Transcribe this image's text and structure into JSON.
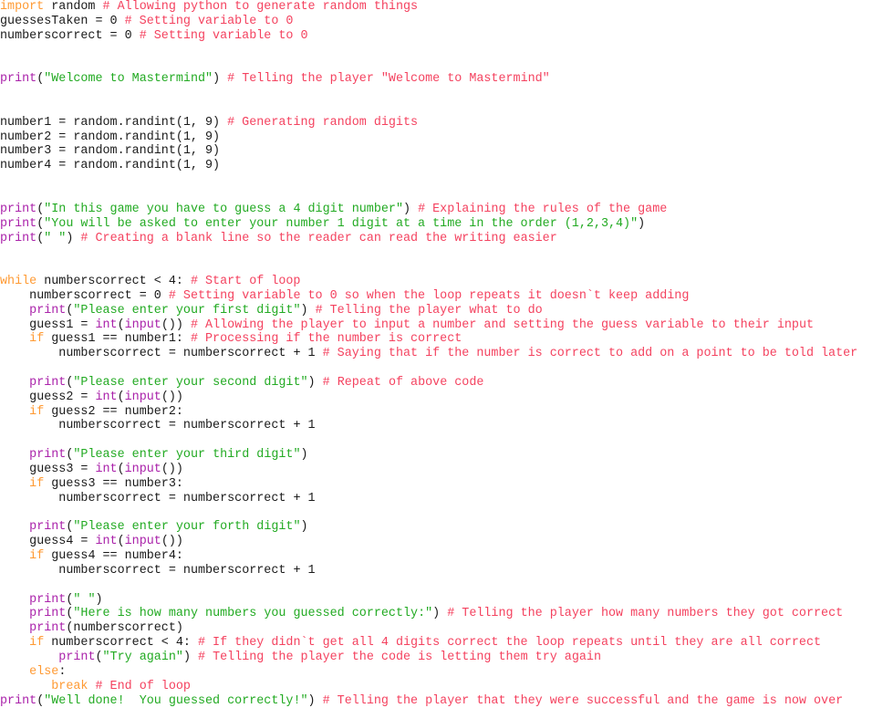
{
  "document": {
    "kind": "source-code-listing",
    "language": "Python",
    "program_title": "Mastermind",
    "background_color": "#ffffff",
    "syntax_colors": {
      "keyword": "#ff9a33",
      "builtin": "#aa22aa",
      "string": "#22aa22",
      "comment": "#f4425f",
      "plain": "#1a1a1a"
    }
  },
  "code": {
    "lines": [
      {
        "n": 1,
        "indent": 0,
        "tokens": [
          {
            "t": "kw",
            "s": "import"
          },
          {
            "t": "plain",
            "s": " random "
          },
          {
            "t": "comment",
            "s": "# Allowing python to generate random things"
          }
        ]
      },
      {
        "n": 2,
        "indent": 0,
        "tokens": [
          {
            "t": "plain",
            "s": "guessesTaken = 0 "
          },
          {
            "t": "comment",
            "s": "# Setting variable to 0"
          }
        ]
      },
      {
        "n": 3,
        "indent": 0,
        "tokens": [
          {
            "t": "plain",
            "s": "numberscorrect = 0 "
          },
          {
            "t": "comment",
            "s": "# Setting variable to 0"
          }
        ]
      },
      {
        "n": 4,
        "indent": 0,
        "tokens": []
      },
      {
        "n": 5,
        "indent": 0,
        "tokens": []
      },
      {
        "n": 6,
        "indent": 0,
        "tokens": [
          {
            "t": "builtin",
            "s": "print"
          },
          {
            "t": "plain",
            "s": "("
          },
          {
            "t": "str",
            "s": "\"Welcome to Mastermind\""
          },
          {
            "t": "plain",
            "s": ") "
          },
          {
            "t": "comment",
            "s": "# Telling the player \"Welcome to Mastermind\""
          }
        ]
      },
      {
        "n": 7,
        "indent": 0,
        "tokens": []
      },
      {
        "n": 8,
        "indent": 0,
        "tokens": []
      },
      {
        "n": 9,
        "indent": 0,
        "tokens": [
          {
            "t": "plain",
            "s": "number1 = random.randint(1, 9) "
          },
          {
            "t": "comment",
            "s": "# Generating random digits"
          }
        ]
      },
      {
        "n": 10,
        "indent": 0,
        "tokens": [
          {
            "t": "plain",
            "s": "number2 = random.randint(1, 9)"
          }
        ]
      },
      {
        "n": 11,
        "indent": 0,
        "tokens": [
          {
            "t": "plain",
            "s": "number3 = random.randint(1, 9)"
          }
        ]
      },
      {
        "n": 12,
        "indent": 0,
        "tokens": [
          {
            "t": "plain",
            "s": "number4 = random.randint(1, 9)"
          }
        ]
      },
      {
        "n": 13,
        "indent": 0,
        "tokens": []
      },
      {
        "n": 14,
        "indent": 0,
        "tokens": []
      },
      {
        "n": 15,
        "indent": 0,
        "tokens": [
          {
            "t": "builtin",
            "s": "print"
          },
          {
            "t": "plain",
            "s": "("
          },
          {
            "t": "str",
            "s": "\"In this game you have to guess a 4 digit number\""
          },
          {
            "t": "plain",
            "s": ") "
          },
          {
            "t": "comment",
            "s": "# Explaining the rules of the game"
          }
        ]
      },
      {
        "n": 16,
        "indent": 0,
        "tokens": [
          {
            "t": "builtin",
            "s": "print"
          },
          {
            "t": "plain",
            "s": "("
          },
          {
            "t": "str",
            "s": "\"You will be asked to enter your number 1 digit at a time in the order (1,2,3,4)\""
          },
          {
            "t": "plain",
            "s": ")"
          }
        ]
      },
      {
        "n": 17,
        "indent": 0,
        "tokens": [
          {
            "t": "builtin",
            "s": "print"
          },
          {
            "t": "plain",
            "s": "("
          },
          {
            "t": "str",
            "s": "\" \""
          },
          {
            "t": "plain",
            "s": ") "
          },
          {
            "t": "comment",
            "s": "# Creating a blank line so the reader can read the writing easier"
          }
        ]
      },
      {
        "n": 18,
        "indent": 0,
        "tokens": []
      },
      {
        "n": 19,
        "indent": 0,
        "tokens": []
      },
      {
        "n": 20,
        "indent": 0,
        "tokens": [
          {
            "t": "kw",
            "s": "while"
          },
          {
            "t": "plain",
            "s": " numberscorrect < 4: "
          },
          {
            "t": "comment",
            "s": "# Start of loop"
          }
        ]
      },
      {
        "n": 21,
        "indent": 4,
        "tokens": [
          {
            "t": "plain",
            "s": "numberscorrect = 0 "
          },
          {
            "t": "comment",
            "s": "# Setting variable to 0 so when the loop repeats it doesn`t keep adding"
          }
        ]
      },
      {
        "n": 22,
        "indent": 4,
        "tokens": [
          {
            "t": "builtin",
            "s": "print"
          },
          {
            "t": "plain",
            "s": "("
          },
          {
            "t": "str",
            "s": "\"Please enter your first digit\""
          },
          {
            "t": "plain",
            "s": ") "
          },
          {
            "t": "comment",
            "s": "# Telling the player what to do"
          }
        ]
      },
      {
        "n": 23,
        "indent": 4,
        "tokens": [
          {
            "t": "plain",
            "s": "guess1 = "
          },
          {
            "t": "builtin",
            "s": "int"
          },
          {
            "t": "plain",
            "s": "("
          },
          {
            "t": "builtin",
            "s": "input"
          },
          {
            "t": "plain",
            "s": "()) "
          },
          {
            "t": "comment",
            "s": "# Allowing the player to input a number and setting the guess variable to their input"
          }
        ]
      },
      {
        "n": 24,
        "indent": 4,
        "tokens": [
          {
            "t": "kw",
            "s": "if"
          },
          {
            "t": "plain",
            "s": " guess1 == number1: "
          },
          {
            "t": "comment",
            "s": "# Processing if the number is correct"
          }
        ]
      },
      {
        "n": 25,
        "indent": 8,
        "tokens": [
          {
            "t": "plain",
            "s": "numberscorrect = numberscorrect + 1 "
          },
          {
            "t": "comment",
            "s": "# Saying that if the number is correct to add on a point to be told later"
          }
        ]
      },
      {
        "n": 26,
        "indent": 0,
        "tokens": []
      },
      {
        "n": 27,
        "indent": 4,
        "tokens": [
          {
            "t": "builtin",
            "s": "print"
          },
          {
            "t": "plain",
            "s": "("
          },
          {
            "t": "str",
            "s": "\"Please enter your second digit\""
          },
          {
            "t": "plain",
            "s": ") "
          },
          {
            "t": "comment",
            "s": "# Repeat of above code"
          }
        ]
      },
      {
        "n": 28,
        "indent": 4,
        "tokens": [
          {
            "t": "plain",
            "s": "guess2 = "
          },
          {
            "t": "builtin",
            "s": "int"
          },
          {
            "t": "plain",
            "s": "("
          },
          {
            "t": "builtin",
            "s": "input"
          },
          {
            "t": "plain",
            "s": "())"
          }
        ]
      },
      {
        "n": 29,
        "indent": 4,
        "tokens": [
          {
            "t": "kw",
            "s": "if"
          },
          {
            "t": "plain",
            "s": " guess2 == number2:"
          }
        ]
      },
      {
        "n": 30,
        "indent": 8,
        "tokens": [
          {
            "t": "plain",
            "s": "numberscorrect = numberscorrect + 1"
          }
        ]
      },
      {
        "n": 31,
        "indent": 0,
        "tokens": []
      },
      {
        "n": 32,
        "indent": 4,
        "tokens": [
          {
            "t": "builtin",
            "s": "print"
          },
          {
            "t": "plain",
            "s": "("
          },
          {
            "t": "str",
            "s": "\"Please enter your third digit\""
          },
          {
            "t": "plain",
            "s": ")"
          }
        ]
      },
      {
        "n": 33,
        "indent": 4,
        "tokens": [
          {
            "t": "plain",
            "s": "guess3 = "
          },
          {
            "t": "builtin",
            "s": "int"
          },
          {
            "t": "plain",
            "s": "("
          },
          {
            "t": "builtin",
            "s": "input"
          },
          {
            "t": "plain",
            "s": "())"
          }
        ]
      },
      {
        "n": 34,
        "indent": 4,
        "tokens": [
          {
            "t": "kw",
            "s": "if"
          },
          {
            "t": "plain",
            "s": " guess3 == number3:"
          }
        ]
      },
      {
        "n": 35,
        "indent": 8,
        "tokens": [
          {
            "t": "plain",
            "s": "numberscorrect = numberscorrect + 1"
          }
        ]
      },
      {
        "n": 36,
        "indent": 0,
        "tokens": []
      },
      {
        "n": 37,
        "indent": 4,
        "tokens": [
          {
            "t": "builtin",
            "s": "print"
          },
          {
            "t": "plain",
            "s": "("
          },
          {
            "t": "str",
            "s": "\"Please enter your forth digit\""
          },
          {
            "t": "plain",
            "s": ")"
          }
        ]
      },
      {
        "n": 38,
        "indent": 4,
        "tokens": [
          {
            "t": "plain",
            "s": "guess4 = "
          },
          {
            "t": "builtin",
            "s": "int"
          },
          {
            "t": "plain",
            "s": "("
          },
          {
            "t": "builtin",
            "s": "input"
          },
          {
            "t": "plain",
            "s": "())"
          }
        ]
      },
      {
        "n": 39,
        "indent": 4,
        "tokens": [
          {
            "t": "kw",
            "s": "if"
          },
          {
            "t": "plain",
            "s": " guess4 == number4:"
          }
        ]
      },
      {
        "n": 40,
        "indent": 8,
        "tokens": [
          {
            "t": "plain",
            "s": "numberscorrect = numberscorrect + 1"
          }
        ]
      },
      {
        "n": 41,
        "indent": 0,
        "tokens": []
      },
      {
        "n": 42,
        "indent": 4,
        "tokens": [
          {
            "t": "builtin",
            "s": "print"
          },
          {
            "t": "plain",
            "s": "("
          },
          {
            "t": "str",
            "s": "\" \""
          },
          {
            "t": "plain",
            "s": ")"
          }
        ]
      },
      {
        "n": 43,
        "indent": 4,
        "tokens": [
          {
            "t": "builtin",
            "s": "print"
          },
          {
            "t": "plain",
            "s": "("
          },
          {
            "t": "str",
            "s": "\"Here is how many numbers you guessed correctly:\""
          },
          {
            "t": "plain",
            "s": ") "
          },
          {
            "t": "comment",
            "s": "# Telling the player how many numbers they got correct"
          }
        ]
      },
      {
        "n": 44,
        "indent": 4,
        "tokens": [
          {
            "t": "builtin",
            "s": "print"
          },
          {
            "t": "plain",
            "s": "(numberscorrect)"
          }
        ]
      },
      {
        "n": 45,
        "indent": 4,
        "tokens": [
          {
            "t": "kw",
            "s": "if"
          },
          {
            "t": "plain",
            "s": " numberscorrect < 4: "
          },
          {
            "t": "comment",
            "s": "# If they didn`t get all 4 digits correct the loop repeats until they are all correct"
          }
        ]
      },
      {
        "n": 46,
        "indent": 8,
        "tokens": [
          {
            "t": "builtin",
            "s": "print"
          },
          {
            "t": "plain",
            "s": "("
          },
          {
            "t": "str",
            "s": "\"Try again\""
          },
          {
            "t": "plain",
            "s": ") "
          },
          {
            "t": "comment",
            "s": "# Telling the player the code is letting them try again"
          }
        ]
      },
      {
        "n": 47,
        "indent": 4,
        "tokens": [
          {
            "t": "kw",
            "s": "else"
          },
          {
            "t": "plain",
            "s": ":"
          }
        ]
      },
      {
        "n": 48,
        "indent": 7,
        "tokens": [
          {
            "t": "kw",
            "s": "break"
          },
          {
            "t": "plain",
            "s": " "
          },
          {
            "t": "comment",
            "s": "# End of loop"
          }
        ]
      },
      {
        "n": 49,
        "indent": 0,
        "tokens": [
          {
            "t": "builtin",
            "s": "print"
          },
          {
            "t": "plain",
            "s": "("
          },
          {
            "t": "str",
            "s": "\"Well done!  You guessed correctly!\""
          },
          {
            "t": "plain",
            "s": ") "
          },
          {
            "t": "comment",
            "s": "# Telling the player that they were successful and the game is now over"
          }
        ]
      }
    ]
  }
}
